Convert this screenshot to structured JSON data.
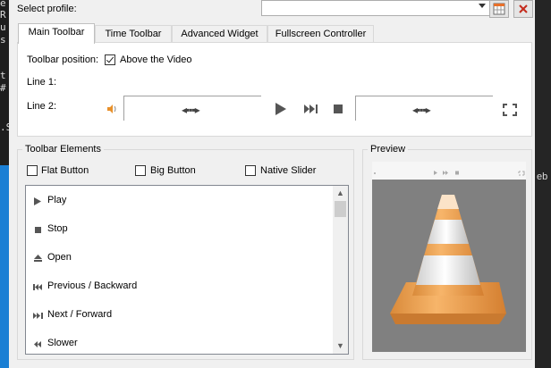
{
  "dialog": {
    "select_profile_label": "Select profile:",
    "profile_value": ""
  },
  "tabs": [
    {
      "label": "Main Toolbar",
      "active": true
    },
    {
      "label": "Time Toolbar",
      "active": false
    },
    {
      "label": "Advanced Widget",
      "active": false
    },
    {
      "label": "Fullscreen Controller",
      "active": false
    }
  ],
  "main_toolbar": {
    "position_label": "Toolbar position:",
    "above_video_label": "Above the Video",
    "above_video_checked": true,
    "line1_label": "Line 1:",
    "line2_label": "Line 2:"
  },
  "elements": {
    "group_title": "Toolbar Elements",
    "flat_button_label": "Flat Button",
    "big_button_label": "Big Button",
    "native_slider_label": "Native Slider",
    "items": [
      {
        "label": "Play",
        "icon": "play-icon"
      },
      {
        "label": "Stop",
        "icon": "stop-icon"
      },
      {
        "label": "Open",
        "icon": "eject-icon"
      },
      {
        "label": "Previous / Backward",
        "icon": "previous-icon"
      },
      {
        "label": "Next / Forward",
        "icon": "next-icon"
      },
      {
        "label": "Slower",
        "icon": "slower-icon"
      }
    ]
  },
  "preview": {
    "title": "Preview"
  },
  "background_text": {
    "left_chars": [
      "e",
      "R",
      "u",
      "s",
      "t",
      "#",
      ".S"
    ],
    "right_chars": [
      "eb"
    ]
  },
  "colors": {
    "accent_blue": "#1a7fd4",
    "close_red": "#c42b1c",
    "cone_orange": "#f0a550"
  }
}
